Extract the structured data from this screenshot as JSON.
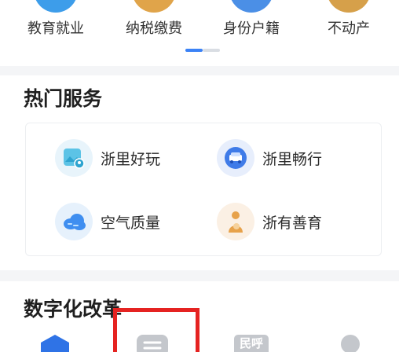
{
  "categories": [
    {
      "label": "教育就业"
    },
    {
      "label": "纳税缴费"
    },
    {
      "label": "身份户籍"
    },
    {
      "label": "不动产"
    }
  ],
  "hot_services": {
    "title": "热门服务",
    "items": [
      {
        "label": "浙里好玩",
        "icon": "scenic-map-icon"
      },
      {
        "label": "浙里畅行",
        "icon": "car-icon"
      },
      {
        "label": "空气质量",
        "icon": "cloud-icon"
      },
      {
        "label": "浙有善育",
        "icon": "mother-baby-icon"
      }
    ]
  },
  "digital_reform": {
    "title": "数字化改革"
  },
  "tab_bar": {
    "tabs": [
      {
        "icon": "home-icon"
      },
      {
        "icon": "list-icon"
      },
      {
        "icon": "minhu-icon",
        "label": "民呼"
      },
      {
        "icon": "profile-icon"
      }
    ]
  },
  "colors": {
    "accent": "#3b82f6",
    "highlight": "#e52321"
  }
}
